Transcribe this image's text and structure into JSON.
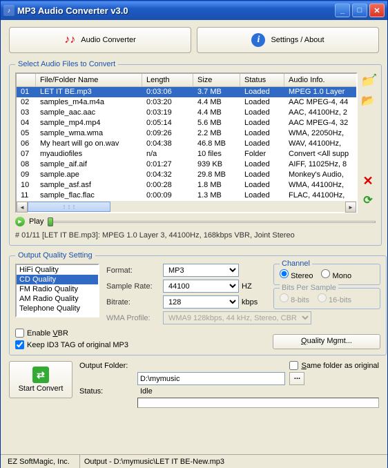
{
  "titlebar": {
    "title": "MP3 Audio Converter v3.0"
  },
  "tabs": {
    "converter": "Audio Converter",
    "settings": "Settings / About"
  },
  "files_section": {
    "legend": "Select Audio Files to Convert",
    "headers": {
      "idx": "",
      "name": "File/Folder Name",
      "length": "Length",
      "size": "Size",
      "status": "Status",
      "info": "Audio Info."
    },
    "rows": [
      {
        "idx": "01",
        "name": "LET IT BE.mp3",
        "length": "0:03:06",
        "size": "3.7 MB",
        "status": "Loaded",
        "info": "MPEG 1.0 Layer"
      },
      {
        "idx": "02",
        "name": "samples_m4a.m4a",
        "length": "0:03:20",
        "size": "4.4 MB",
        "status": "Loaded",
        "info": "AAC MPEG-4, 44"
      },
      {
        "idx": "03",
        "name": "sample_aac.aac",
        "length": "0:03:19",
        "size": "4.4 MB",
        "status": "Loaded",
        "info": "AAC, 44100Hz, 2"
      },
      {
        "idx": "04",
        "name": "sample_mp4.mp4",
        "length": "0:05:14",
        "size": "5.6 MB",
        "status": "Loaded",
        "info": "AAC MPEG-4, 32"
      },
      {
        "idx": "05",
        "name": "sample_wma.wma",
        "length": "0:09:26",
        "size": "2.2 MB",
        "status": "Loaded",
        "info": "WMA, 22050Hz,"
      },
      {
        "idx": "06",
        "name": "My heart will go on.wav",
        "length": "0:04:38",
        "size": "46.8 MB",
        "status": "Loaded",
        "info": "WAV, 44100Hz,"
      },
      {
        "idx": "07",
        "name": "myaudiofiles",
        "length": "n/a",
        "size": "10 files",
        "status": "Folder",
        "info": "Convert <All supp"
      },
      {
        "idx": "08",
        "name": "sample_aif.aif",
        "length": "0:01:27",
        "size": "939 KB",
        "status": "Loaded",
        "info": "AIFF, 11025Hz, 8"
      },
      {
        "idx": "09",
        "name": "sample.ape",
        "length": "0:04:32",
        "size": "29.8 MB",
        "status": "Loaded",
        "info": "Monkey's Audio,"
      },
      {
        "idx": "10",
        "name": "sample_asf.asf",
        "length": "0:00:28",
        "size": "1.8 MB",
        "status": "Loaded",
        "info": "WMA, 44100Hz,"
      },
      {
        "idx": "11",
        "name": "sample_flac.flac",
        "length": "0:00:09",
        "size": "1.3 MB",
        "status": "Loaded",
        "info": "FLAC, 44100Hz,"
      }
    ]
  },
  "play": {
    "label": "Play"
  },
  "fileinfo": "# 01/11 [LET IT BE.mp3]: MPEG 1.0 Layer 3, 44100Hz, 168kbps VBR, Joint Stereo",
  "quality": {
    "legend": "Output Quality Setting",
    "presets": [
      "HiFi Quality",
      "CD Quality",
      "FM Radio Quality",
      "AM Radio Quality",
      "Telephone Quality"
    ],
    "selected_preset": 1,
    "format_label": "Format:",
    "format_value": "MP3",
    "sample_label": "Sample Rate:",
    "sample_value": "44100",
    "sample_unit": "HZ",
    "bitrate_label": "Bitrate:",
    "bitrate_value": "128",
    "bitrate_unit": "kbps",
    "wma_label": "WMA Profile:",
    "wma_value": "WMA9 128kbps, 44 kHz, Stereo, CBR",
    "channel_label": "Channel",
    "stereo": "Stereo",
    "mono": "Mono",
    "bps_label": "Bits Per Sample",
    "b8": "8-bits",
    "b16": "16-bits",
    "vbr": "Enable VBR",
    "keepid3": "Keep ID3 TAG of original MP3",
    "qmbtn": "Quality Mgmt..."
  },
  "output": {
    "convert": "Start Convert",
    "folder_label": "Output Folder:",
    "folder_value": "D:\\mymusic",
    "same_folder": "Same folder as original",
    "status_label": "Status:",
    "status_value": "Idle"
  },
  "statusbar": {
    "company": "EZ SoftMagic, Inc.",
    "output": "Output  -  D:\\mymusic\\LET IT BE-New.mp3"
  }
}
